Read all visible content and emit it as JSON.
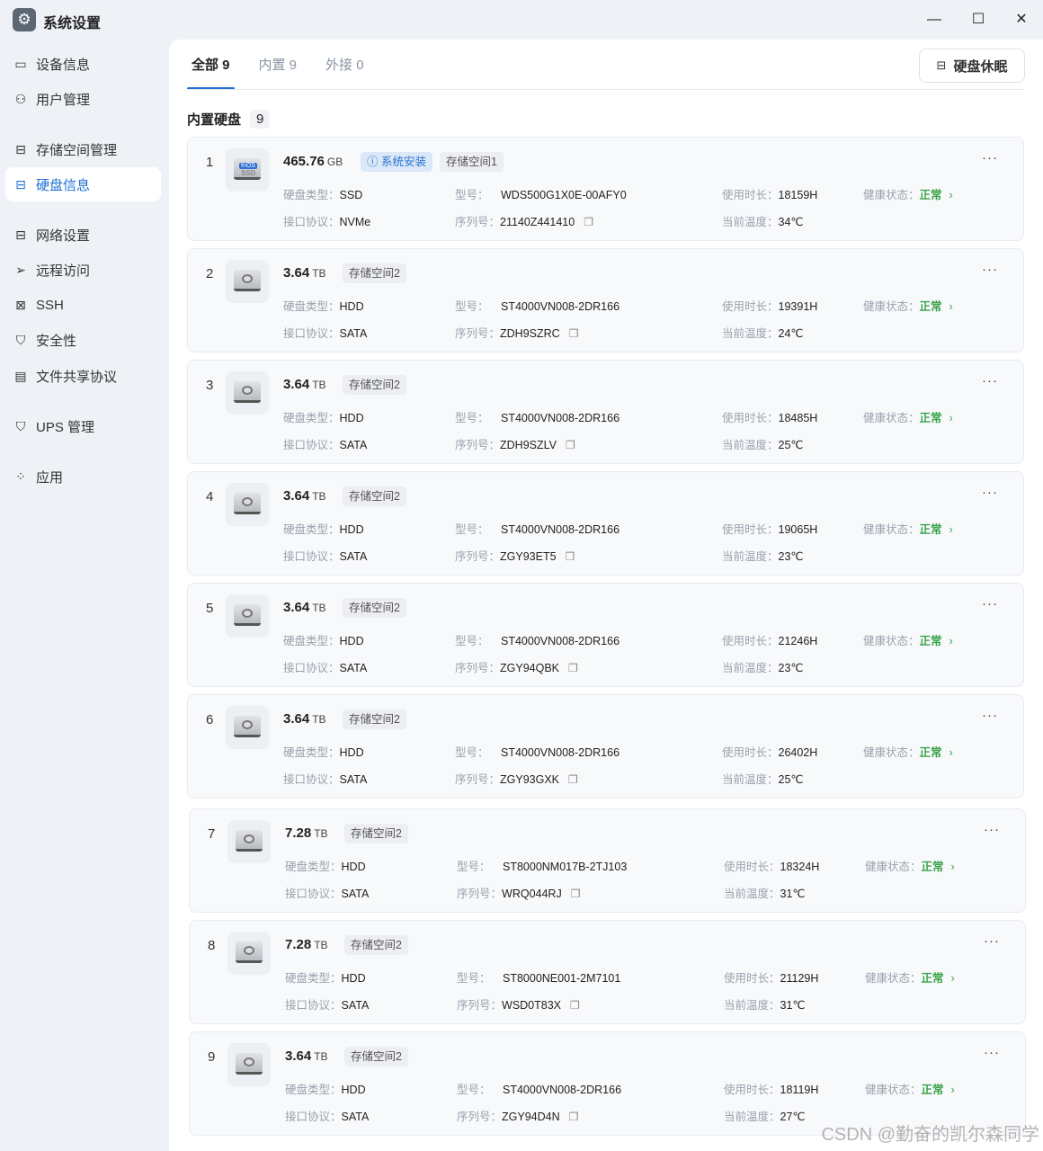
{
  "window": {
    "title": "系统设置",
    "app_icon": "gear-icon",
    "minimize": "—",
    "maximize": "☐",
    "close": "✕"
  },
  "sidebar": {
    "items": [
      {
        "label": "设备信息",
        "icon": "monitor-icon",
        "glyph": "▭"
      },
      {
        "label": "用户管理",
        "icon": "user-gear-icon",
        "glyph": "⚇"
      },
      {
        "label": "存储空间管理",
        "icon": "storage-icon",
        "glyph": "⊟"
      },
      {
        "label": "硬盘信息",
        "icon": "disk-icon",
        "glyph": "⊟",
        "active": true
      },
      {
        "label": "网络设置",
        "icon": "network-icon",
        "glyph": "⊟"
      },
      {
        "label": "远程访问",
        "icon": "send-icon",
        "glyph": "➢"
      },
      {
        "label": "SSH",
        "icon": "code-icon",
        "glyph": "⊠"
      },
      {
        "label": "安全性",
        "icon": "shield-icon",
        "glyph": "⛉"
      },
      {
        "label": "文件共享协议",
        "icon": "file-icon",
        "glyph": "▤"
      },
      {
        "label": "UPS 管理",
        "icon": "ups-shield-icon",
        "glyph": "⛉"
      },
      {
        "label": "应用",
        "icon": "apps-icon",
        "glyph": "⁘"
      }
    ]
  },
  "tabs": [
    {
      "label": "全部 9",
      "active": true
    },
    {
      "label": "内置 9"
    },
    {
      "label": "外接 0"
    }
  ],
  "sleep_button": "硬盘休眠",
  "section": {
    "title": "内置硬盘",
    "count": "9"
  },
  "labels": {
    "type": "硬盘类型：",
    "model": "型号：",
    "hours": "使用时长：",
    "health": "健康状态：",
    "protocol": "接口协议：",
    "serial": "序列号：",
    "temp": "当前温度："
  },
  "disks": [
    {
      "num": "1",
      "size": "465.76",
      "unit": "GB",
      "ssd": true,
      "system_badge": "系统安装",
      "pool": "存储空间1",
      "type": "SSD",
      "model": "WDS500G1X0E-00AFY0",
      "hours": "18159H",
      "health": "正常",
      "protocol": "NVMe",
      "serial": "21140Z441410",
      "temp": "34℃"
    },
    {
      "num": "2",
      "size": "3.64",
      "unit": "TB",
      "pool": "存储空间2",
      "type": "HDD",
      "model": "ST4000VN008-2DR166",
      "hours": "19391H",
      "health": "正常",
      "protocol": "SATA",
      "serial": "ZDH9SZRC",
      "temp": "24℃"
    },
    {
      "num": "3",
      "size": "3.64",
      "unit": "TB",
      "pool": "存储空间2",
      "type": "HDD",
      "model": "ST4000VN008-2DR166",
      "hours": "18485H",
      "health": "正常",
      "protocol": "SATA",
      "serial": "ZDH9SZLV",
      "temp": "25℃"
    },
    {
      "num": "4",
      "size": "3.64",
      "unit": "TB",
      "pool": "存储空间2",
      "type": "HDD",
      "model": "ST4000VN008-2DR166",
      "hours": "19065H",
      "health": "正常",
      "protocol": "SATA",
      "serial": "ZGY93ET5",
      "temp": "23℃"
    },
    {
      "num": "5",
      "size": "3.64",
      "unit": "TB",
      "pool": "存储空间2",
      "type": "HDD",
      "model": "ST4000VN008-2DR166",
      "hours": "21246H",
      "health": "正常",
      "protocol": "SATA",
      "serial": "ZGY94QBK",
      "temp": "23℃"
    },
    {
      "num": "6",
      "size": "3.64",
      "unit": "TB",
      "pool": "存储空间2",
      "type": "HDD",
      "model": "ST4000VN008-2DR166",
      "hours": "26402H",
      "health": "正常",
      "protocol": "SATA",
      "serial": "ZGY93GXK",
      "temp": "25℃"
    },
    {
      "num": "7",
      "size": "7.28",
      "unit": "TB",
      "pool": "存储空间2",
      "type": "HDD",
      "model": "ST8000NM017B-2TJ103",
      "hours": "18324H",
      "health": "正常",
      "protocol": "SATA",
      "serial": "WRQ044RJ",
      "temp": "31℃"
    },
    {
      "num": "8",
      "size": "7.28",
      "unit": "TB",
      "pool": "存储空间2",
      "type": "HDD",
      "model": "ST8000NE001-2M7101",
      "hours": "21129H",
      "health": "正常",
      "protocol": "SATA",
      "serial": "WSD0T83X",
      "temp": "31℃"
    },
    {
      "num": "9",
      "size": "3.64",
      "unit": "TB",
      "pool": "存储空间2",
      "type": "HDD",
      "model": "ST4000VN008-2DR166",
      "hours": "18119H",
      "health": "正常",
      "protocol": "SATA",
      "serial": "ZGY94D4N",
      "temp": "27℃"
    }
  ],
  "watermark": "CSDN @勤奋的凯尔森同学"
}
